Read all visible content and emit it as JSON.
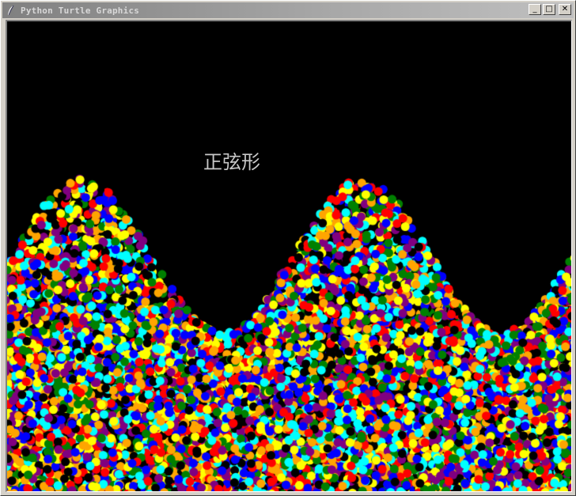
{
  "window": {
    "title": "Python Turtle Graphics",
    "icon": "feather-icon",
    "controls": [
      {
        "name": "minimize-button",
        "glyph": "_"
      },
      {
        "name": "maximize-button",
        "glyph": "□"
      },
      {
        "name": "close-button",
        "glyph": "✕"
      }
    ]
  },
  "canvas": {
    "background": "#000000",
    "label": "正弦形",
    "dot_colors": [
      "#ff0000",
      "#ffff00",
      "#00ffff",
      "#0000ff",
      "#008000",
      "#800080",
      "#ffa500",
      "#000000"
    ]
  }
}
